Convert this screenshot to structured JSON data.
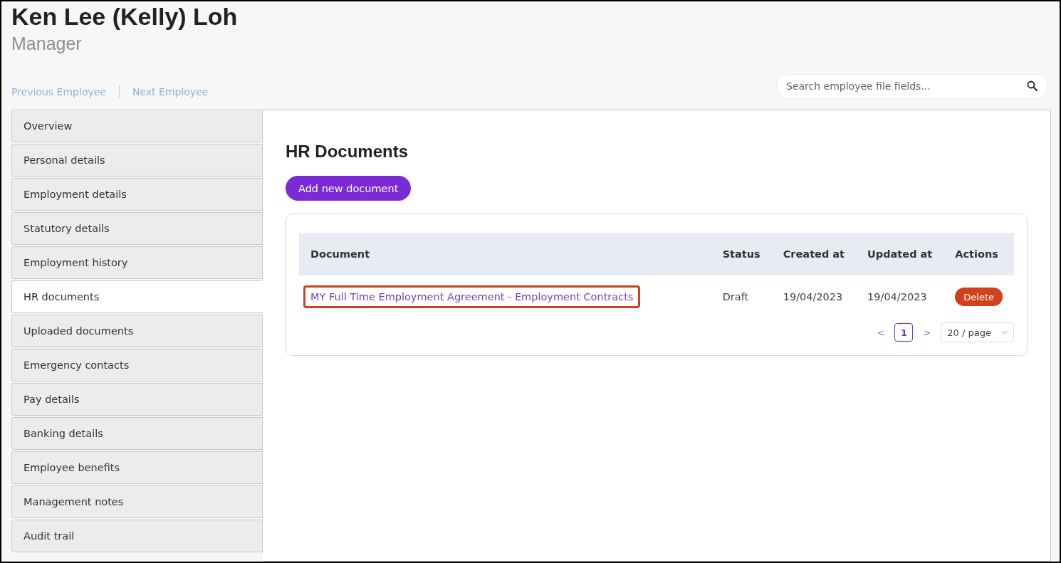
{
  "employee": {
    "name": "Ken Lee (Kelly) Loh",
    "role": "Manager"
  },
  "nav": {
    "previous": "Previous Employee",
    "next": "Next Employee"
  },
  "search": {
    "placeholder": "Search employee file fields..."
  },
  "sidebar": {
    "items": [
      {
        "label": "Overview",
        "selected": false
      },
      {
        "label": "Personal details",
        "selected": false
      },
      {
        "label": "Employment details",
        "selected": false
      },
      {
        "label": "Statutory details",
        "selected": false
      },
      {
        "label": "Employment history",
        "selected": false
      },
      {
        "label": "HR documents",
        "selected": true
      },
      {
        "label": "Uploaded documents",
        "selected": false
      },
      {
        "label": "Emergency contacts",
        "selected": false
      },
      {
        "label": "Pay details",
        "selected": false
      },
      {
        "label": "Banking details",
        "selected": false
      },
      {
        "label": "Employee benefits",
        "selected": false
      },
      {
        "label": "Management notes",
        "selected": false
      },
      {
        "label": "Audit trail",
        "selected": false
      }
    ]
  },
  "content": {
    "title": "HR Documents",
    "add_button": "Add new document",
    "table": {
      "columns": [
        "Document",
        "Status",
        "Created at",
        "Updated at",
        "Actions"
      ],
      "rows": [
        {
          "document": "MY Full Time Employment Agreement - Employment Contracts",
          "highlighted": true,
          "status": "Draft",
          "created_at": "19/04/2023",
          "updated_at": "19/04/2023",
          "action": "Delete"
        }
      ]
    },
    "pagination": {
      "prev": "<",
      "pages": [
        {
          "label": "1",
          "selected": true
        }
      ],
      "next": ">",
      "page_size": "20 / page"
    }
  }
}
